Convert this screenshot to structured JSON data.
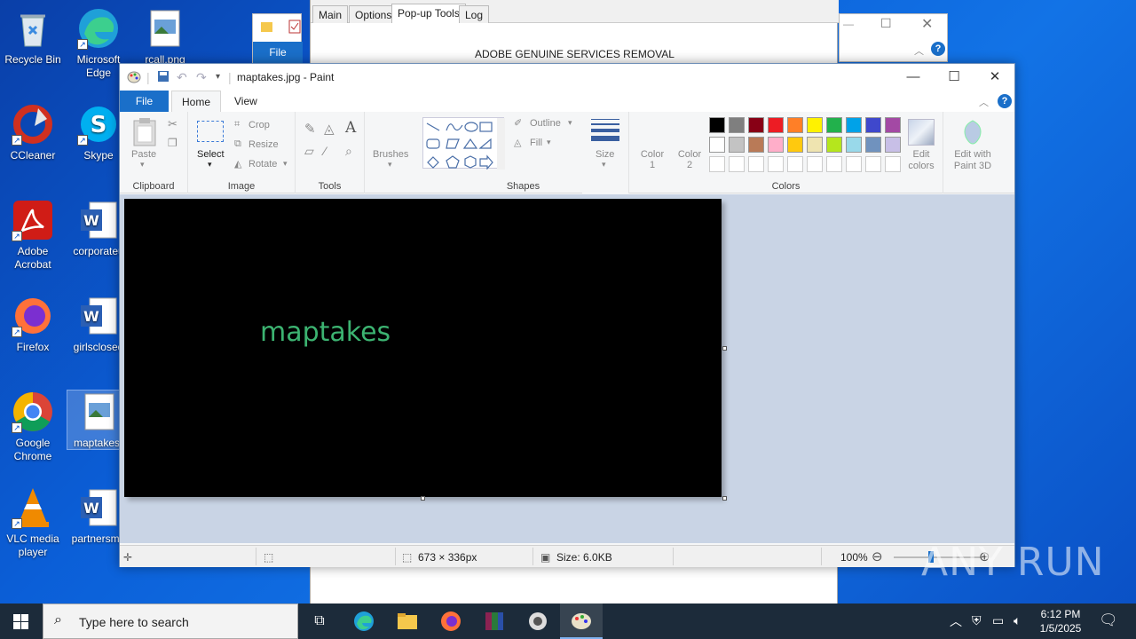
{
  "desktop": {
    "icons": [
      {
        "label": "Recycle Bin"
      },
      {
        "label": "Microsoft Edge"
      },
      {
        "label": "rcall.png"
      },
      {
        "label": "CCleaner"
      },
      {
        "label": "Skype"
      },
      {
        "label": "Adobe Acrobat"
      },
      {
        "label": "corporateu"
      },
      {
        "label": "Firefox"
      },
      {
        "label": "girlsclosed"
      },
      {
        "label": "Google Chrome"
      },
      {
        "label": "maptakes.j"
      },
      {
        "label": "VLC media player"
      },
      {
        "label": "partnersme"
      }
    ]
  },
  "bg_window": {
    "tabs": [
      "Main",
      "Options",
      "Pop-up Tools",
      "Log"
    ],
    "title": "ADOBE GENUINE SERVICES REMOVAL"
  },
  "explorer": {
    "file_label": "File"
  },
  "paint": {
    "title": "maptakes.jpg - Paint",
    "tabs": {
      "file": "File",
      "home": "Home",
      "view": "View"
    },
    "groups": {
      "clipboard": "Clipboard",
      "image": "Image",
      "tools": "Tools",
      "shapes": "Shapes",
      "colors": "Colors"
    },
    "buttons": {
      "paste": "Paste",
      "select": "Select",
      "crop": "Crop",
      "resize": "Resize",
      "rotate": "Rotate",
      "brushes": "Brushes",
      "outline": "Outline",
      "fill": "Fill",
      "size": "Size",
      "color1": "Color 1",
      "color2": "Color 2",
      "edit_colors": "Edit colors",
      "edit_paint3d": "Edit with Paint 3D"
    },
    "palette_row1": [
      "#000000",
      "#7f7f7f",
      "#880015",
      "#ed1c24",
      "#ff7f27",
      "#fff200",
      "#22b14c",
      "#00a2e8",
      "#3f48cc",
      "#a349a4"
    ],
    "palette_row2": [
      "#ffffff",
      "#c3c3c3",
      "#b97a57",
      "#ffaec9",
      "#ffc90e",
      "#efe4b0",
      "#b5e61d",
      "#99d9ea",
      "#7092be",
      "#c8bfe7"
    ],
    "canvas_text": "maptakes",
    "status": {
      "dimensions": "673 × 336px",
      "size": "Size: 6.0KB",
      "zoom": "100%"
    }
  },
  "taskbar": {
    "search_placeholder": "Type here to search",
    "time": "6:12 PM",
    "date": "1/5/2025"
  },
  "watermark": "ANY RUN"
}
